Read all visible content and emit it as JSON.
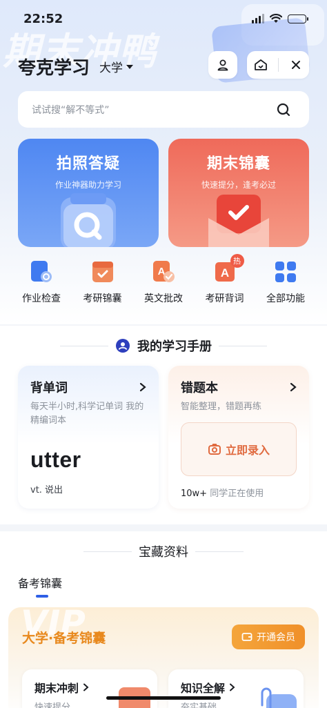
{
  "status_bar": {
    "time": "22:52"
  },
  "header": {
    "banner_text": "期末冲鸭",
    "app_title": "夸克学习",
    "level": "大学"
  },
  "search": {
    "placeholder": "试试搜“解不等式”"
  },
  "feature_cards": [
    {
      "title": "拍照答疑",
      "subtitle": "作业神器助力学习",
      "color": "#4f87f2"
    },
    {
      "title": "期末锦囊",
      "subtitle": "快速提分，逢考必过",
      "color": "#ef6a5a"
    }
  ],
  "quick_actions": [
    {
      "label": "作业检查",
      "icon": "homework-check-icon"
    },
    {
      "label": "考研锦囊",
      "icon": "exam-kit-icon"
    },
    {
      "label": "英文批改",
      "icon": "english-correction-icon"
    },
    {
      "label": "考研背词",
      "icon": "vocab-icon",
      "badge": "热"
    },
    {
      "label": "全部功能",
      "icon": "grid-icon"
    }
  ],
  "handbook": {
    "title": "我的学习手册",
    "vocab_card": {
      "title": "背单词",
      "subtitle": "每天半小时,科学记单词 我的精编词本",
      "word": "utter",
      "meaning": "vt. 说出"
    },
    "mistakes_card": {
      "title": "错题本",
      "subtitle": "智能整理，错题再练",
      "action": "立即录入",
      "users_count": "10w+",
      "users_text": "同学正在使用"
    }
  },
  "treasure": {
    "title": "宝藏资料",
    "tab": "备考锦囊",
    "vip_card": {
      "bg_text": "VIP",
      "title": "大学·备考锦囊",
      "button": "开通会员",
      "items": [
        {
          "title": "期末冲刺",
          "subtitle": "快速提分"
        },
        {
          "title": "知识全解",
          "subtitle": "夯实基础"
        }
      ]
    }
  },
  "colors": {
    "accent": "#2e5fe6",
    "vip": "#f0902a",
    "hot": "#ef5b46"
  }
}
